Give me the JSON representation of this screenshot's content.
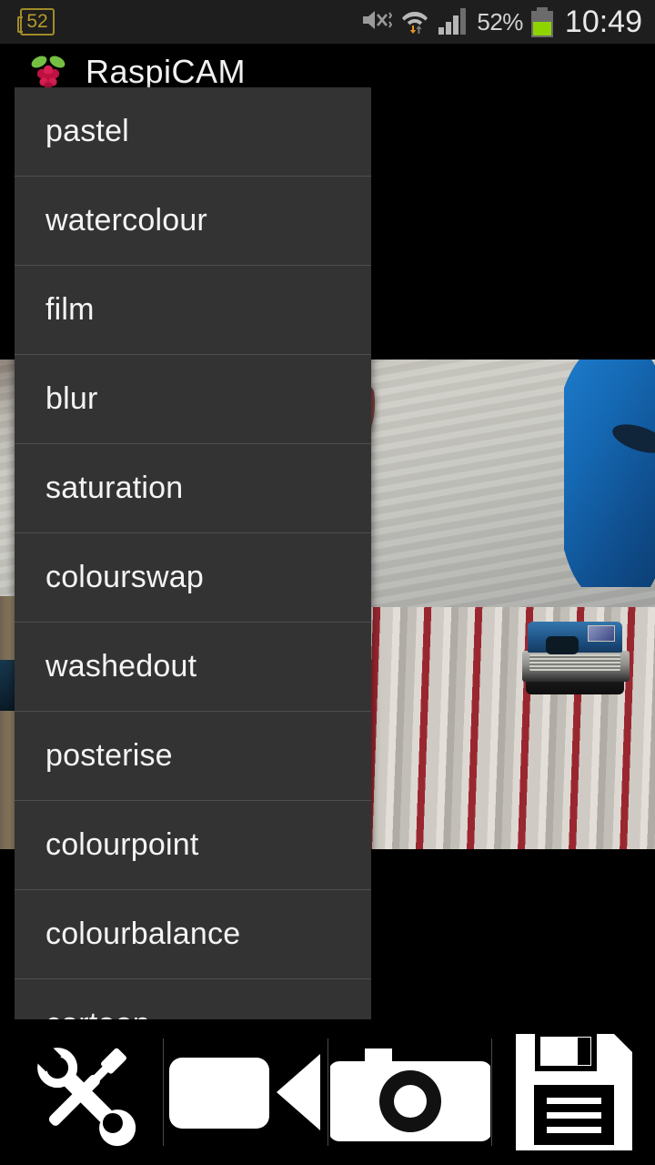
{
  "status_bar": {
    "notification_count": "52",
    "battery_percent": "52%",
    "clock": "10:49",
    "icons": {
      "notification_badge": "notification-count-badge",
      "mute": "volume-mute-vibrate-icon",
      "wifi": "wifi-icon",
      "data_transfer": "data-transfer-arrows-icon",
      "signal": "cellular-signal-icon",
      "battery": "battery-icon"
    },
    "colors": {
      "badge_outline": "#a08c28",
      "badge_text": "#b59a2c",
      "battery_fill": "#8fd400",
      "bar_background": "#1e1e1e",
      "text": "#d2d2d2"
    }
  },
  "app_header": {
    "title": "RaspiCAM",
    "logo": "raspberry-pi-logo"
  },
  "effects_menu": {
    "background": "#333333",
    "divider": "#4e4e4e",
    "text_color": "#f4f4f4",
    "items": [
      {
        "label": "pastel"
      },
      {
        "label": "watercolour"
      },
      {
        "label": "film"
      },
      {
        "label": "blur"
      },
      {
        "label": "saturation"
      },
      {
        "label": "colourswap"
      },
      {
        "label": "washedout"
      },
      {
        "label": "posterise"
      },
      {
        "label": "colourpoint"
      },
      {
        "label": "colourbalance"
      },
      {
        "label": "cartoon"
      }
    ]
  },
  "camera_preview": {
    "description": "Live camera preview of a room ceiling with a red lampshade, a blue object, a wooden door, red-and-white striped wallpaper, a ceiling-mounted projector and a dark chair back."
  },
  "toolbar": {
    "buttons": [
      {
        "name": "settings-tools-button",
        "icon": "wrench-screwdriver-icon",
        "label": "Settings"
      },
      {
        "name": "video-record-button",
        "icon": "video-camera-icon",
        "label": "Record Video"
      },
      {
        "name": "capture-photo-button",
        "icon": "photo-camera-icon",
        "label": "Take Photo"
      },
      {
        "name": "save-button",
        "icon": "floppy-disk-icon",
        "label": "Save"
      }
    ]
  }
}
